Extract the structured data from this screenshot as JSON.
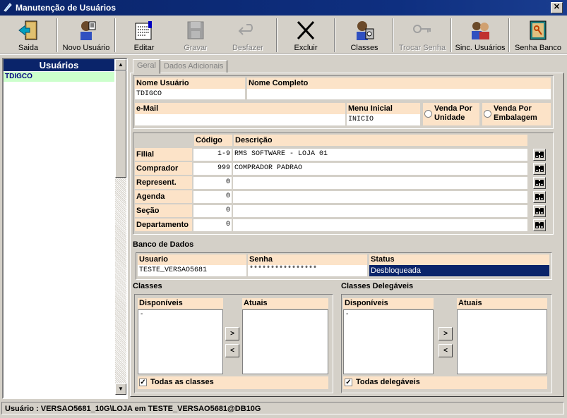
{
  "window": {
    "title": "Manutenção de Usuários",
    "close_glyph": "✕"
  },
  "toolbar": {
    "buttons": [
      {
        "label": "Saida",
        "icon": "exit-door-icon",
        "enabled": true
      },
      {
        "label": "Novo Usuário",
        "icon": "new-user-icon",
        "enabled": true
      },
      {
        "label": "Editar",
        "icon": "edit-form-icon",
        "enabled": true
      },
      {
        "label": "Gravar",
        "icon": "save-disk-icon",
        "enabled": false
      },
      {
        "label": "Desfazer",
        "icon": "undo-icon",
        "enabled": false
      },
      {
        "label": "Excluir",
        "icon": "delete-x-icon",
        "enabled": true
      },
      {
        "label": "Classes",
        "icon": "classes-icon",
        "enabled": true
      },
      {
        "label": "Trocar Senha",
        "icon": "keys-icon",
        "enabled": false
      },
      {
        "label": "Sinc. Usuários",
        "icon": "sync-users-icon",
        "enabled": true
      },
      {
        "label": "Senha Banco",
        "icon": "db-password-icon",
        "enabled": true
      }
    ]
  },
  "users_panel": {
    "header": "Usuários",
    "items": [
      "TDIGCO"
    ]
  },
  "tabs": {
    "geral": "Geral",
    "dados_adicionais": "Dados Adicionais"
  },
  "form": {
    "nome_usuario_label": "Nome Usuário",
    "nome_usuario_value": "TDIGCO",
    "nome_completo_label": "Nome Completo",
    "nome_completo_value": "",
    "email_label": "e-Mail",
    "email_value": "",
    "menu_inicial_label": "Menu Inicial",
    "menu_inicial_value": "INICIO",
    "venda_unidade": "Venda Por Unidade",
    "venda_embalagem": "Venda Por Embalagem"
  },
  "grid": {
    "col_codigo": "Código",
    "col_descricao": "Descrição",
    "rows": [
      {
        "label": "Filial",
        "codigo": "1-9",
        "descricao": "RMS SOFTWARE - LOJA 01"
      },
      {
        "label": "Comprador",
        "codigo": "999",
        "descricao": "COMPRADOR PADRAO"
      },
      {
        "label": "Represent.",
        "codigo": "0",
        "descricao": ""
      },
      {
        "label": "Agenda",
        "codigo": "0",
        "descricao": ""
      },
      {
        "label": "Seção",
        "codigo": "0",
        "descricao": ""
      },
      {
        "label": "Departamento",
        "codigo": "0",
        "descricao": ""
      }
    ]
  },
  "banco": {
    "title": "Banco de Dados",
    "usuario_label": "Usuario",
    "usuario_value": "TESTE_VERSAO5681",
    "senha_label": "Senha",
    "senha_value": "****************",
    "status_label": "Status",
    "status_value": "Desbloqueada",
    "status_color": "#0a246a"
  },
  "classes": {
    "title": "Classes",
    "disponiveis": "Disponíveis",
    "disponiveis_item": "-",
    "atuais": "Atuais",
    "todas": "Todas as classes",
    "todas_checked": true
  },
  "delegaveis": {
    "title": "Classes Delegáveis",
    "disponiveis": "Disponíveis",
    "disponiveis_item": "-",
    "atuais": "Atuais",
    "todas": "Todas delegáveis",
    "todas_checked": true
  },
  "arrows": {
    "add": ">",
    "remove": "<"
  },
  "statusbar": {
    "text": "Usuário : VERSAO5681_10G\\LOJA em TESTE_VERSAO5681@DB10G"
  },
  "colors": {
    "label_bg": "#fce3c8",
    "title_bar": "#0a246a",
    "selected_user_bg": "#ccffcc"
  }
}
